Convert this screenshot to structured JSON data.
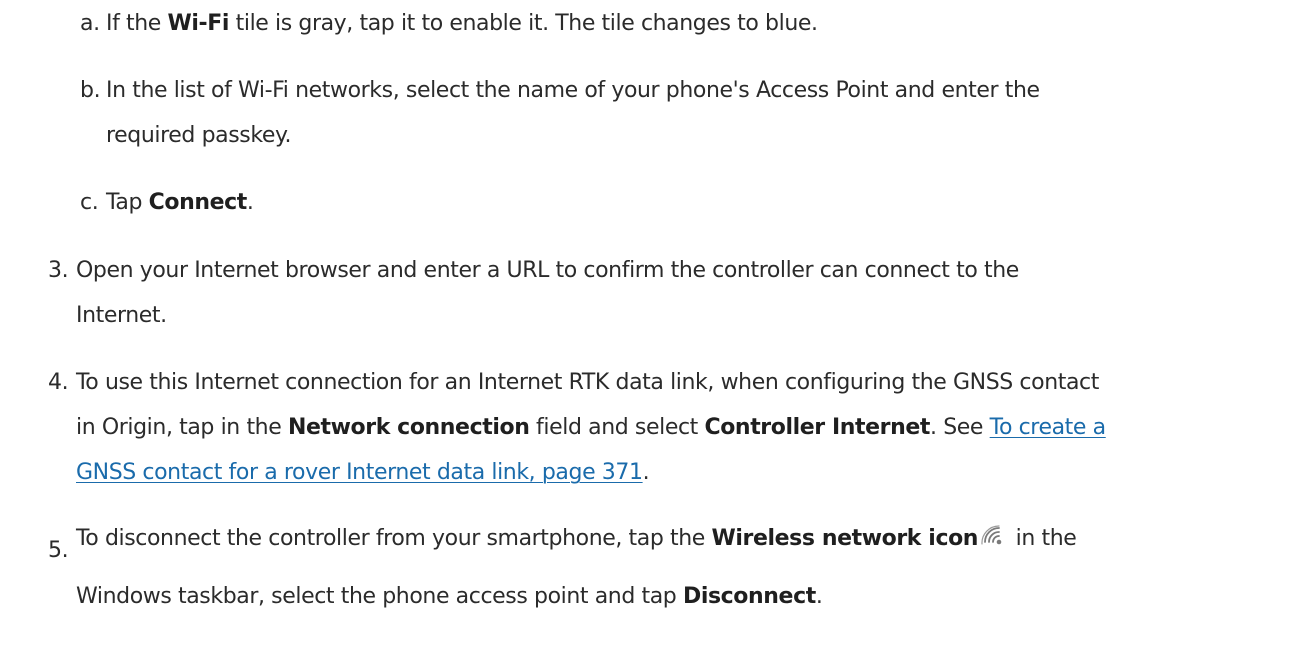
{
  "sub_steps": [
    {
      "marker": "a.",
      "text_1": "If the ",
      "bold_1": "Wi-Fi",
      "text_2": " tile is gray, tap it to enable it. The tile changes to blue."
    },
    {
      "marker": "b.",
      "line_1": "In the list of Wi-Fi networks, select the name of your phone's Access Point and enter the",
      "line_2": "required passkey."
    },
    {
      "marker": "c.",
      "text_1": "Tap ",
      "bold_1": "Connect",
      "text_2": "."
    }
  ],
  "steps": [
    {
      "marker": "3.",
      "line_1": "Open your Internet browser and enter a URL to confirm the controller can connect to the",
      "line_2": "Internet."
    },
    {
      "marker": "4.",
      "line_1": "To use this Internet connection for an Internet RTK data link, when configuring the GNSS contact",
      "line_2_text_1": "in Origin, tap in the ",
      "line_2_bold_1": "Network connection",
      "line_2_text_2": " field and select ",
      "line_2_bold_2": "Controller Internet",
      "line_2_text_3": ". See ",
      "link_line_1": "To create a",
      "link_line_2": "GNSS contact for a rover Internet data link, page 371",
      "line_3_text_1": "."
    },
    {
      "marker": "5.",
      "line_1_text_1": "To disconnect the controller from your smartphone, tap the ",
      "line_1_bold_1": "Wireless network icon",
      "line_1_text_2": " in the",
      "line_2_text_1": "Windows taskbar, select the phone access point and tap ",
      "line_2_bold_1": "Disconnect",
      "line_2_text_2": "."
    }
  ],
  "icons": {
    "wireless": "wireless-network-icon"
  },
  "colors": {
    "text": "#2b2b2b",
    "link": "#1a6bab",
    "icon": "#7a7a7a"
  }
}
